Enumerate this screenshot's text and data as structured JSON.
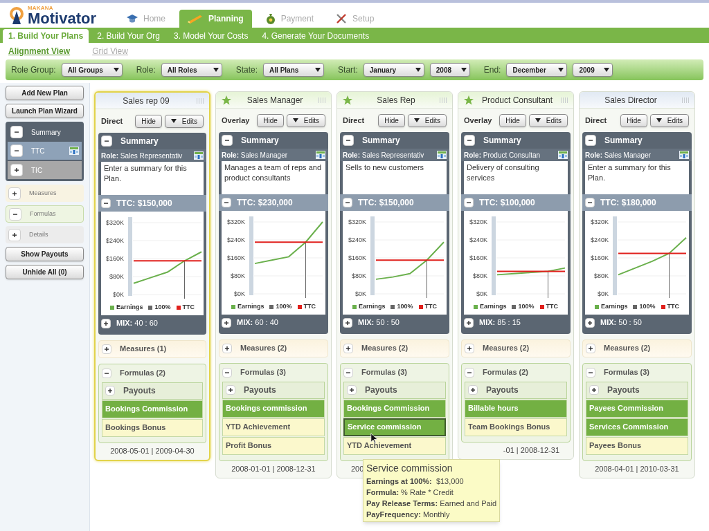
{
  "logo": {
    "brand": "MAKANA",
    "product": "Motivator"
  },
  "nav_tabs": [
    {
      "label": "Home",
      "selected": false
    },
    {
      "label": "Planning",
      "selected": true
    },
    {
      "label": "Payment",
      "selected": false
    },
    {
      "label": "Setup",
      "selected": false
    }
  ],
  "sub_tabs": [
    {
      "label": "1. Build Your Plans",
      "selected": true
    },
    {
      "label": "2. Build Your Org",
      "selected": false
    },
    {
      "label": "3. Model Your Costs",
      "selected": false
    },
    {
      "label": "4. Generate Your Documents",
      "selected": false
    }
  ],
  "views": [
    {
      "label": "Alignment View",
      "selected": true
    },
    {
      "label": "Grid View",
      "selected": false
    }
  ],
  "filters": [
    {
      "label": "Role Group:",
      "selects": [
        "All Groups"
      ]
    },
    {
      "label": "Role:",
      "selects": [
        "All Roles"
      ]
    },
    {
      "label": "State:",
      "selects": [
        "All Plans"
      ]
    },
    {
      "label": "Start:",
      "selects": [
        "January",
        "2008"
      ]
    },
    {
      "label": "End:",
      "selects": [
        "December",
        "2009"
      ]
    }
  ],
  "sidebar": {
    "buttons_top": [
      "Add New Plan",
      "Launch Plan Wizard"
    ],
    "summary_group": {
      "label": "Summary",
      "expanded": true,
      "children": [
        {
          "label": "TTC",
          "expanded": true,
          "selected": true,
          "icon": true
        },
        {
          "label": "TIC",
          "expanded": false,
          "selected": false,
          "icon": false
        }
      ]
    },
    "sections": [
      {
        "label": "Measures",
        "kind": "measures",
        "expanded": false
      },
      {
        "label": "Formulas",
        "kind": "formulas",
        "expanded": true
      },
      {
        "label": "Details",
        "kind": "details",
        "expanded": false
      }
    ],
    "buttons_bottom": [
      "Show Payouts",
      "Unhide All (0)"
    ]
  },
  "plans": [
    {
      "title": "Sales rep 09",
      "starred": false,
      "selected": true,
      "type": "Direct",
      "hide": "Hide",
      "edits": "Edits",
      "summary_label": "Summary",
      "summary_expanded": true,
      "role": "**Role:** Sales Representativ",
      "summary": "Enter a summary for this Plan.",
      "ttc": "TTC: $150,000",
      "ttc_expanded": true,
      "chart_data": {
        "type": "line",
        "grid": true,
        "legend": "bottom",
        "ylim": [
          0,
          320000
        ],
        "yticks": [
          {
            "value": 0,
            "label": "$0K"
          },
          {
            "value": 80000,
            "label": "$80K"
          },
          {
            "value": 160000,
            "label": "$160K"
          },
          {
            "value": 240000,
            "label": "$240K"
          },
          {
            "value": 320000,
            "label": "$320K"
          }
        ],
        "series": [
          {
            "name": "Earnings",
            "color": "#6ab04c",
            "values": [
              50000,
              75000,
              100000,
              150000,
              190000
            ]
          },
          {
            "name": "TTC",
            "color": "#e0201c",
            "values": [
              150000,
              150000,
              150000,
              150000,
              150000
            ]
          }
        ],
        "categories": [
          null,
          null,
          null,
          null,
          null
        ]
      },
      "marker_label": "100%",
      "mix": "**MIX:** 40 : 60",
      "mix_expanded": false,
      "measures": "Measures (1)",
      "measures_expanded": false,
      "formulas": "Formulas (2)",
      "formulas_expanded": true,
      "payouts": "Payouts",
      "payouts_expanded": false,
      "items": [
        {
          "label": "Bookings Commission",
          "highlighted": true,
          "hovered": false
        },
        {
          "label": "Bookings Bonus",
          "highlighted": false,
          "hovered": false
        }
      ],
      "dates": "2008-05-01 | 2009-04-30",
      "dates_cut_start": false,
      "dates_cut_end": false
    },
    {
      "title": "Sales Manager",
      "starred": true,
      "selected": false,
      "type": "Overlay",
      "hide": "Hide",
      "edits": "Edits",
      "summary_label": "Summary",
      "summary_expanded": true,
      "role": "**Role:** Sales Manager",
      "summary": "Manages a team of reps and product consultants",
      "ttc": "TTC: $230,000",
      "ttc_expanded": true,
      "chart_data": {
        "type": "line",
        "grid": true,
        "legend": "bottom",
        "ylim": [
          0,
          320000
        ],
        "yticks": [
          {
            "value": 0,
            "label": "$0K"
          },
          {
            "value": 80000,
            "label": "$80K"
          },
          {
            "value": 160000,
            "label": "$160K"
          },
          {
            "value": 240000,
            "label": "$240K"
          },
          {
            "value": 320000,
            "label": "$320K"
          }
        ],
        "series": [
          {
            "name": "Earnings",
            "color": "#6ab04c",
            "values": [
              135000,
              150000,
              165000,
              230000,
              320000
            ]
          },
          {
            "name": "TTC",
            "color": "#e0201c",
            "values": [
              230000,
              230000,
              230000,
              230000,
              230000
            ]
          }
        ],
        "categories": [
          null,
          null,
          null,
          null,
          null
        ]
      },
      "marker_label": "100%",
      "mix": "**MIX:** 60 : 40",
      "mix_expanded": false,
      "measures": "Measures (2)",
      "measures_expanded": false,
      "formulas": "Formulas (3)",
      "formulas_expanded": true,
      "payouts": "Payouts",
      "payouts_expanded": false,
      "items": [
        {
          "label": "Bookings commission",
          "highlighted": true,
          "hovered": false
        },
        {
          "label": "YTD Achievement",
          "highlighted": false,
          "hovered": false
        },
        {
          "label": "Profit Bonus",
          "highlighted": false,
          "hovered": false
        }
      ],
      "dates": "2008-01-01 | 2008-12-31",
      "dates_cut_start": false,
      "dates_cut_end": false
    },
    {
      "title": "Sales Rep",
      "starred": true,
      "selected": false,
      "type": "Direct",
      "hide": "Hide",
      "edits": "Edits",
      "summary_label": "Summary",
      "summary_expanded": true,
      "role": "**Role:** Sales Representativ",
      "summary": "Sells to new customers",
      "ttc": "TTC: $150,000",
      "ttc_expanded": true,
      "chart_data": {
        "type": "line",
        "grid": true,
        "legend": "bottom",
        "ylim": [
          0,
          320000
        ],
        "yticks": [
          {
            "value": 0,
            "label": "$0K"
          },
          {
            "value": 80000,
            "label": "$80K"
          },
          {
            "value": 160000,
            "label": "$160K"
          },
          {
            "value": 240000,
            "label": "$240K"
          },
          {
            "value": 320000,
            "label": "$320K"
          }
        ],
        "series": [
          {
            "name": "Earnings",
            "color": "#6ab04c",
            "values": [
              65000,
              75000,
              90000,
              150000,
              230000
            ]
          },
          {
            "name": "TTC",
            "color": "#e0201c",
            "values": [
              150000,
              150000,
              150000,
              150000,
              150000
            ]
          }
        ],
        "categories": [
          null,
          null,
          null,
          null,
          null
        ]
      },
      "marker_label": "100%",
      "mix": "**MIX:** 50 : 50",
      "mix_expanded": false,
      "measures": "Measures (2)",
      "measures_expanded": false,
      "formulas": "Formulas (3)",
      "formulas_expanded": true,
      "payouts": "Payouts",
      "payouts_expanded": false,
      "items": [
        {
          "label": "Bookings Commission",
          "highlighted": true,
          "hovered": false
        },
        {
          "label": "Service commission",
          "highlighted": true,
          "hovered": true
        },
        {
          "label": "YTD Achievement",
          "highlighted": false,
          "hovered": false
        }
      ],
      "dates": "200",
      "dates_cut_start": false,
      "dates_cut_end": true
    },
    {
      "title": "Product Consultant",
      "starred": true,
      "selected": false,
      "type": "Overlay",
      "hide": "Hide",
      "edits": "Edits",
      "summary_label": "Summary",
      "summary_expanded": true,
      "role": "**Role:** Product Consultan",
      "summary": "Delivery of consulting services",
      "ttc": "TTC: $100,000",
      "ttc_expanded": true,
      "chart_data": {
        "type": "line",
        "grid": true,
        "legend": "bottom",
        "ylim": [
          0,
          320000
        ],
        "yticks": [
          {
            "value": 0,
            "label": "$0K"
          },
          {
            "value": 80000,
            "label": "$80K"
          },
          {
            "value": 160000,
            "label": "$160K"
          },
          {
            "value": 240000,
            "label": "$240K"
          },
          {
            "value": 320000,
            "label": "$320K"
          }
        ],
        "series": [
          {
            "name": "Earnings",
            "color": "#6ab04c",
            "values": [
              85000,
              90000,
              95000,
              100000,
              115000
            ]
          },
          {
            "name": "TTC",
            "color": "#e0201c",
            "values": [
              100000,
              100000,
              100000,
              100000,
              100000
            ]
          }
        ],
        "categories": [
          null,
          null,
          null,
          null,
          null
        ]
      },
      "marker_label": "100%",
      "mix": "**MIX:** 85 : 15",
      "mix_expanded": false,
      "measures": "Measures (2)",
      "measures_expanded": false,
      "formulas": "Formulas (2)",
      "formulas_expanded": true,
      "payouts": "Payouts",
      "payouts_expanded": false,
      "items": [
        {
          "label": "Billable hours",
          "highlighted": true,
          "hovered": false
        },
        {
          "label": "Team Bookings Bonus",
          "highlighted": false,
          "hovered": false
        }
      ],
      "dates": "-01 | 2008-12-31",
      "dates_cut_start": true,
      "dates_cut_end": false
    },
    {
      "title": "Sales Director",
      "starred": false,
      "selected": false,
      "type": "Direct",
      "hide": "Hide",
      "edits": "Edits",
      "summary_label": "Summary",
      "summary_expanded": true,
      "role": "**Role:** Sales Manager",
      "summary": "Enter a summary for this Plan.",
      "ttc": "TTC: $180,000",
      "ttc_expanded": true,
      "chart_data": {
        "type": "line",
        "grid": true,
        "legend": "bottom",
        "ylim": [
          0,
          320000
        ],
        "yticks": [
          {
            "value": 0,
            "label": "$0K"
          },
          {
            "value": 80000,
            "label": "$80K"
          },
          {
            "value": 160000,
            "label": "$160K"
          },
          {
            "value": 240000,
            "label": "$240K"
          },
          {
            "value": 320000,
            "label": "$320K"
          }
        ],
        "series": [
          {
            "name": "Earnings",
            "color": "#6ab04c",
            "values": [
              85000,
              115000,
              145000,
              180000,
              250000
            ]
          },
          {
            "name": "TTC",
            "color": "#e0201c",
            "values": [
              180000,
              180000,
              180000,
              180000,
              180000
            ]
          }
        ],
        "categories": [
          null,
          null,
          null,
          null,
          null
        ]
      },
      "marker_label": "100%",
      "mix": "**MIX:** 50 : 50",
      "mix_expanded": false,
      "measures": "Measures (2)",
      "measures_expanded": false,
      "formulas": "Formulas (3)",
      "formulas_expanded": true,
      "payouts": "Payouts",
      "payouts_expanded": false,
      "items": [
        {
          "label": "Payees Commission",
          "highlighted": true,
          "hovered": false
        },
        {
          "label": "Services Commission",
          "highlighted": true,
          "hovered": false
        },
        {
          "label": "Payees Bonus",
          "highlighted": false,
          "hovered": false
        }
      ],
      "dates": "2008-04-01 | 2010-03-31",
      "dates_cut_start": false,
      "dates_cut_end": false
    }
  ],
  "tooltip": {
    "title": "Service commission",
    "lines": [
      "**Earnings at 100%:**  $13,000",
      "**Formula:** % Rate * Credit",
      "**Pay Release Terms:** Earned and Paid",
      "**PayFrequency:** Monthly"
    ]
  }
}
